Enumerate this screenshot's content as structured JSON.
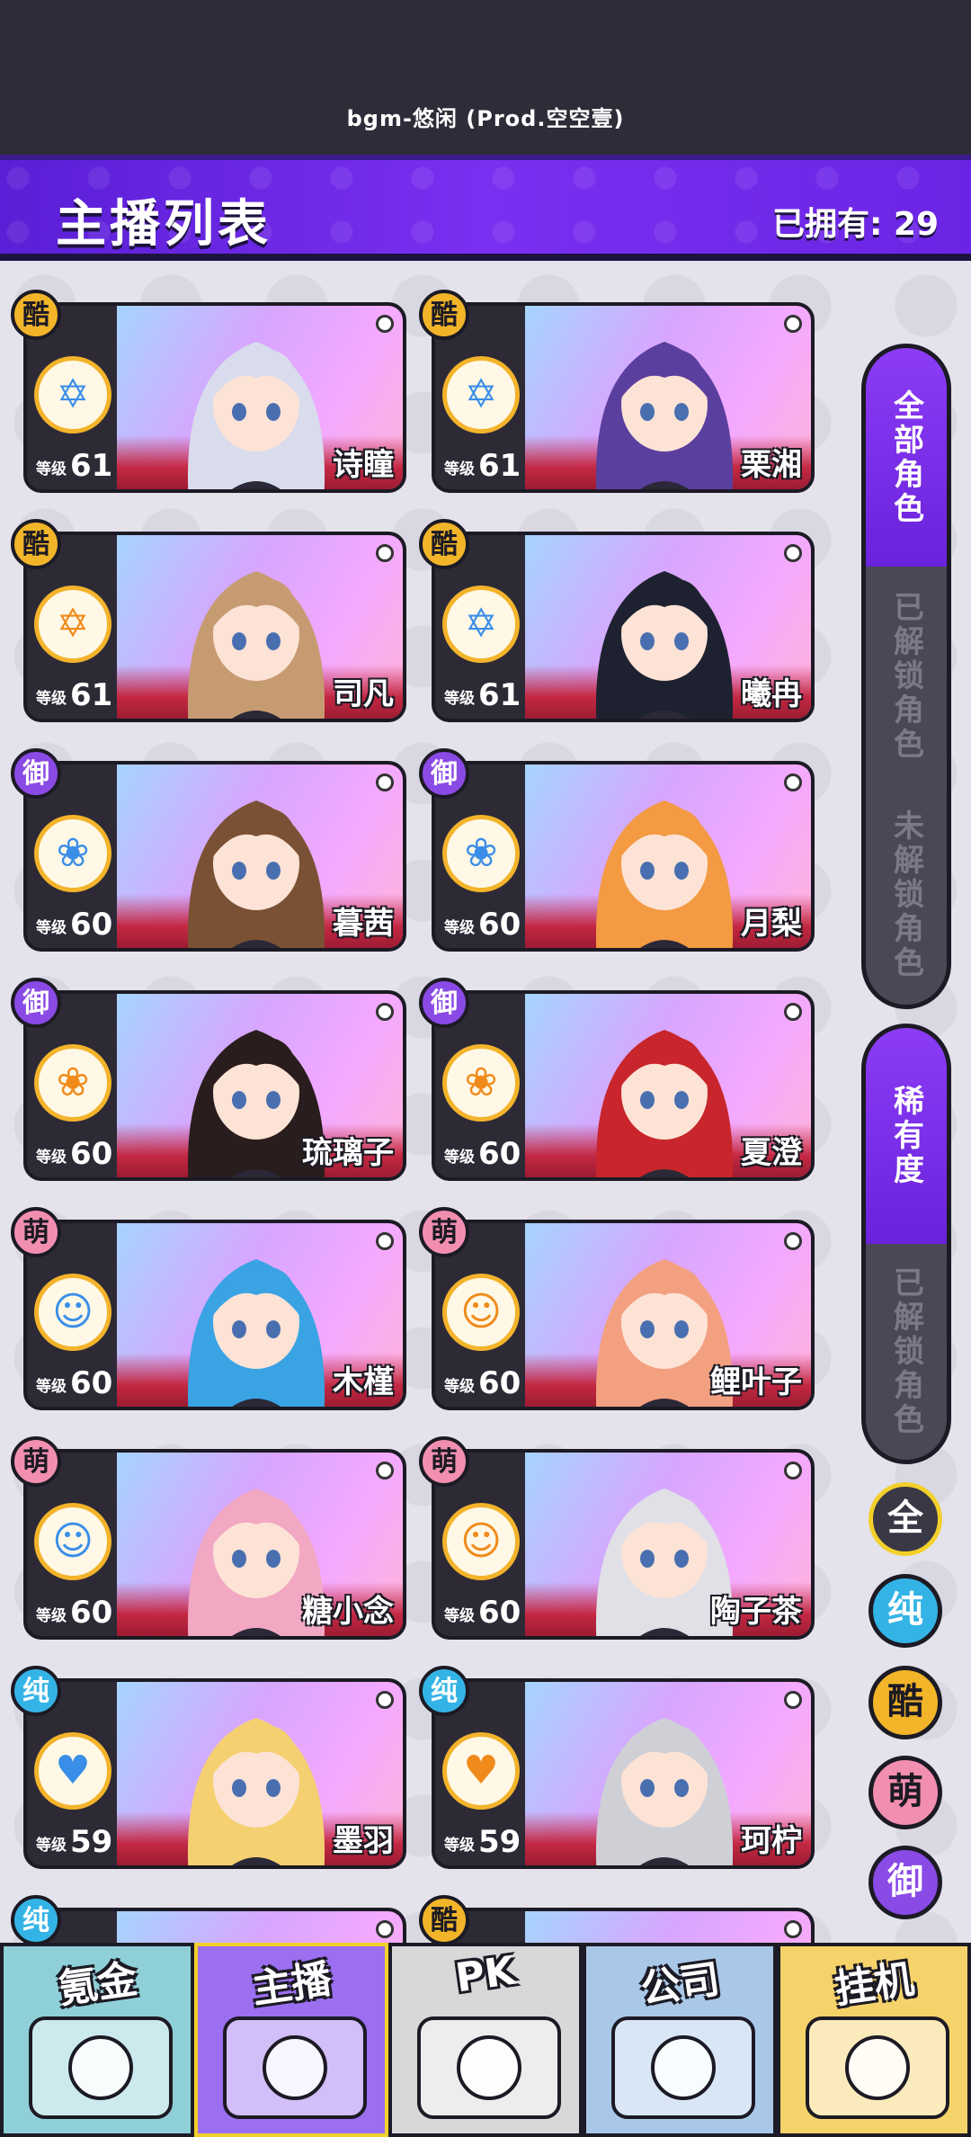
{
  "status_bar": {
    "bgm": "bgm-悠闲 (Prod.空空壹)"
  },
  "header": {
    "title": "主播列表",
    "owned": "已拥有: 29"
  },
  "cards": [
    {
      "type": "酷",
      "type_class": "ku",
      "emblem": "✡",
      "emblem_color": "blue",
      "level_label": "等级",
      "level": "61",
      "name": "诗瞳",
      "hair": "#d9dcec"
    },
    {
      "type": "酷",
      "type_class": "ku",
      "emblem": "✡",
      "emblem_color": "blue",
      "level_label": "等级",
      "level": "61",
      "name": "栗湘",
      "hair": "#5b3f9e"
    },
    {
      "type": "酷",
      "type_class": "ku",
      "emblem": "✡",
      "emblem_color": "orange",
      "level_label": "等级",
      "level": "61",
      "name": "司凡",
      "hair": "#c79b72"
    },
    {
      "type": "酷",
      "type_class": "ku",
      "emblem": "✡",
      "emblem_color": "blue",
      "level_label": "等级",
      "level": "61",
      "name": "曦冉",
      "hair": "#1e2230"
    },
    {
      "type": "御",
      "type_class": "yu",
      "emblem": "❀",
      "emblem_color": "blue",
      "level_label": "等级",
      "level": "60",
      "name": "暮茜",
      "hair": "#7a5134"
    },
    {
      "type": "御",
      "type_class": "yu",
      "emblem": "❀",
      "emblem_color": "blue",
      "level_label": "等级",
      "level": "60",
      "name": "月梨",
      "hair": "#f39a43"
    },
    {
      "type": "御",
      "type_class": "yu",
      "emblem": "❀",
      "emblem_color": "orange",
      "level_label": "等级",
      "level": "60",
      "name": "琉璃子",
      "hair": "#2a1d1d"
    },
    {
      "type": "御",
      "type_class": "yu",
      "emblem": "❀",
      "emblem_color": "orange",
      "level_label": "等级",
      "level": "60",
      "name": "夏澄",
      "hair": "#c8262c"
    },
    {
      "type": "萌",
      "type_class": "meng",
      "emblem": "☺",
      "emblem_color": "blue",
      "level_label": "等级",
      "level": "60",
      "name": "木槿",
      "hair": "#3aa3e4"
    },
    {
      "type": "萌",
      "type_class": "meng",
      "emblem": "☺",
      "emblem_color": "orange",
      "level_label": "等级",
      "level": "60",
      "name": "鲤叶子",
      "hair": "#f3a080"
    },
    {
      "type": "萌",
      "type_class": "meng",
      "emblem": "☺",
      "emblem_color": "blue",
      "level_label": "等级",
      "level": "60",
      "name": "糖小念",
      "hair": "#f2a8c2"
    },
    {
      "type": "萌",
      "type_class": "meng",
      "emblem": "☺",
      "emblem_color": "orange",
      "level_label": "等级",
      "level": "60",
      "name": "陶子茶",
      "hair": "#e0e0e6"
    },
    {
      "type": "纯",
      "type_class": "chun",
      "emblem": "♥",
      "emblem_color": "blue",
      "level_label": "等级",
      "level": "59",
      "name": "墨羽",
      "hair": "#f5d070"
    },
    {
      "type": "纯",
      "type_class": "chun",
      "emblem": "♥",
      "emblem_color": "orange",
      "level_label": "等级",
      "level": "59",
      "name": "珂柠",
      "hair": "#cfd0d6"
    },
    {
      "type": "纯",
      "type_class": "chun",
      "emblem": "",
      "emblem_color": "blue",
      "level_label": "",
      "level": "",
      "name": "",
      "hair": "#c9c9d6"
    },
    {
      "type": "酷",
      "type_class": "ku",
      "emblem": "",
      "emblem_color": "blue",
      "level_label": "",
      "level": "",
      "name": "",
      "hair": "#d6c8b8"
    }
  ],
  "filter_role": {
    "tabs": [
      "全部角色",
      "已解锁角色",
      "未解锁角色"
    ],
    "active": 0
  },
  "filter_rarity": {
    "tabs": [
      "稀有度",
      "已解锁角色"
    ],
    "active": 0
  },
  "type_buttons": [
    {
      "label": "全",
      "bg": "#3a3845",
      "fg": "#ffffff",
      "ring": "#f3d02b"
    },
    {
      "label": "纯",
      "bg": "#34b4e6",
      "fg": "#ffffff",
      "ring": "#1c1a24"
    },
    {
      "label": "酷",
      "bg": "#f2b52a",
      "fg": "#1c1a24",
      "ring": "#1c1a24"
    },
    {
      "label": "萌",
      "bg": "#f28fb0",
      "fg": "#1c1a24",
      "ring": "#1c1a24"
    },
    {
      "label": "御",
      "bg": "#8a4ae6",
      "fg": "#ffffff",
      "ring": "#1c1a24"
    }
  ],
  "bottom_nav": [
    {
      "label": "氪金",
      "bg": "#8fd0d8",
      "active": false
    },
    {
      "label": "主播",
      "bg": "#9b6ff0",
      "active": true
    },
    {
      "label": "PK",
      "bg": "#d8d8d8",
      "active": false
    },
    {
      "label": "公司",
      "bg": "#a9c8e8",
      "active": false
    },
    {
      "label": "挂机",
      "bg": "#f6d36a",
      "active": false
    }
  ]
}
